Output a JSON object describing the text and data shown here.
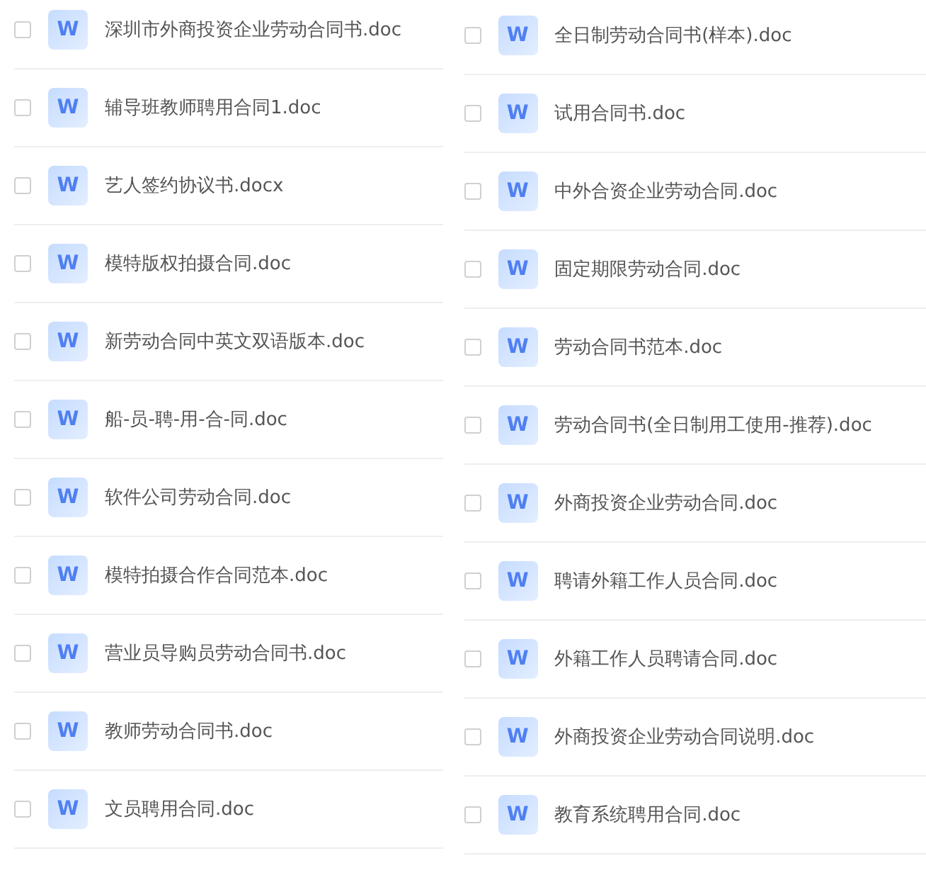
{
  "columns": [
    {
      "files": [
        {
          "name": "深圳市外商投资企业劳动合同书.doc",
          "icon": "W",
          "checked": false
        },
        {
          "name": "辅导班教师聘用合同1.doc",
          "icon": "W",
          "checked": false
        },
        {
          "name": "艺人签约协议书.docx",
          "icon": "W",
          "checked": false
        },
        {
          "name": "模特版权拍摄合同.doc",
          "icon": "W",
          "checked": false
        },
        {
          "name": "新劳动合同中英文双语版本.doc",
          "icon": "W",
          "checked": false
        },
        {
          "name": "船-员-聘-用-合-同.doc",
          "icon": "W",
          "checked": false
        },
        {
          "name": "软件公司劳动合同.doc",
          "icon": "W",
          "checked": false
        },
        {
          "name": "模特拍摄合作合同范本.doc",
          "icon": "W",
          "checked": false
        },
        {
          "name": "营业员导购员劳动合同书.doc",
          "icon": "W",
          "checked": false
        },
        {
          "name": "教师劳动合同书.doc",
          "icon": "W",
          "checked": false
        },
        {
          "name": "文员聘用合同.doc",
          "icon": "W",
          "checked": false
        }
      ]
    },
    {
      "files": [
        {
          "name": "全日制劳动合同书(样本).doc",
          "icon": "W",
          "checked": false
        },
        {
          "name": "试用合同书.doc",
          "icon": "W",
          "checked": false
        },
        {
          "name": "中外合资企业劳动合同.doc",
          "icon": "W",
          "checked": false
        },
        {
          "name": "固定期限劳动合同.doc",
          "icon": "W",
          "checked": false
        },
        {
          "name": "劳动合同书范本.doc",
          "icon": "W",
          "checked": false
        },
        {
          "name": "劳动合同书(全日制用工使用-推荐).doc",
          "icon": "W",
          "checked": false
        },
        {
          "name": "外商投资企业劳动合同.doc",
          "icon": "W",
          "checked": false
        },
        {
          "name": "聘请外籍工作人员合同.doc",
          "icon": "W",
          "checked": false
        },
        {
          "name": "外籍工作人员聘请合同.doc",
          "icon": "W",
          "checked": false
        },
        {
          "name": "外商投资企业劳动合同说明.doc",
          "icon": "W",
          "checked": false
        },
        {
          "name": "教育系统聘用合同.doc",
          "icon": "W",
          "checked": false
        }
      ]
    }
  ]
}
